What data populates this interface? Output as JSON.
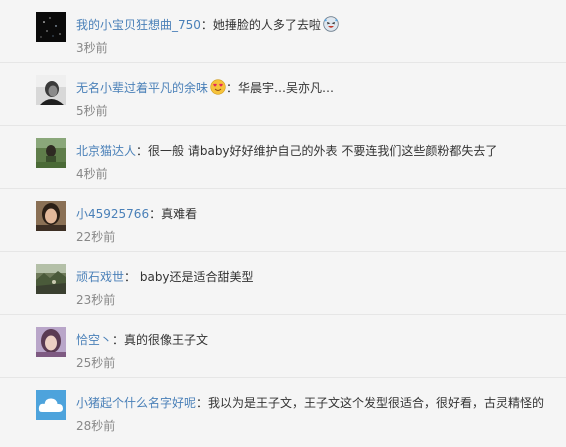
{
  "comments": [
    {
      "username": "我的小宝贝狂想曲_750",
      "separator": "：",
      "text": "她捶脸的人多了去啦",
      "time": "3秒前",
      "avatar": "starry-night-avatar",
      "emoji_after_text": "laughing-face-icon"
    },
    {
      "username": "无名小辈过着平凡的余味",
      "separator": "：",
      "text": "华晨宇…吴亦凡…",
      "time": "5秒前",
      "avatar": "portrait-bw-avatar",
      "emoji_after_name": "heart-eyes-face-icon"
    },
    {
      "username": "北京猫达人",
      "separator": "：",
      "text": "很一般 请baby好好维护自己的外表 不要连我们这些颜粉都失去了",
      "time": "4秒前",
      "avatar": "outdoor-photo-avatar"
    },
    {
      "username": "小45925766",
      "separator": "：",
      "text": "真难看",
      "time": "22秒前",
      "avatar": "face-photo-avatar"
    },
    {
      "username": "顽石戏世",
      "separator": "：",
      "text": " baby还是适合甜美型",
      "time": "23秒前",
      "avatar": "landscape-photo-avatar"
    },
    {
      "username": "恰空丶",
      "separator": "：",
      "text": "真的很像王子文",
      "time": "25秒前",
      "avatar": "purple-portrait-avatar"
    },
    {
      "username": "小猪起个什么名字好呢",
      "separator": "：",
      "text": "我以为是王子文，王子文这个发型很适合，很好看，古灵精怪的",
      "time": "28秒前",
      "avatar": "blue-cloud-avatar"
    }
  ],
  "colors": {
    "background": "#f5f5f5",
    "username_link": "#4a80b8",
    "text": "#333333",
    "time": "#888888",
    "divider": "#e6e6e6"
  }
}
